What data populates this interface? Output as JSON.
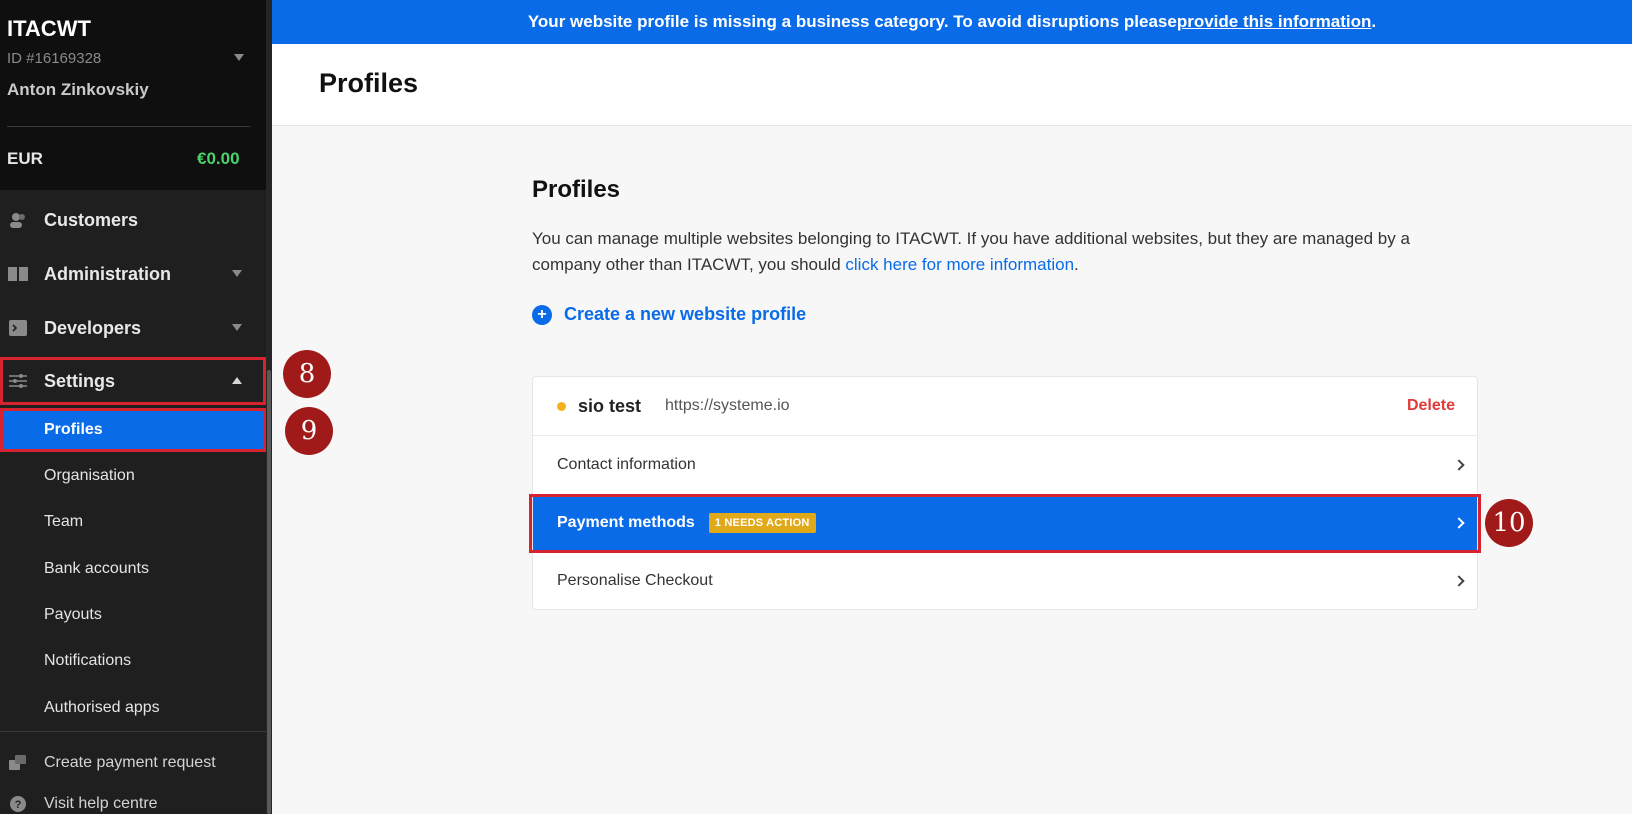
{
  "sidebar": {
    "org_name": "ITACWT",
    "org_id": "ID #16169328",
    "user_name": "Anton Zinkovskiy",
    "currency": "EUR",
    "balance": "€0.00",
    "nav": [
      {
        "label": "Customers",
        "icon": "customers-icon"
      },
      {
        "label": "Administration",
        "icon": "book-icon"
      },
      {
        "label": "Developers",
        "icon": "terminal-icon"
      },
      {
        "label": "Settings",
        "icon": "sliders-icon"
      }
    ],
    "settings_sub": [
      "Profiles",
      "Organisation",
      "Team",
      "Bank accounts",
      "Payouts",
      "Notifications",
      "Authorised apps"
    ],
    "footer": [
      {
        "label": "Create payment request",
        "icon": "payment-request-icon"
      },
      {
        "label": "Visit help centre",
        "icon": "help-icon"
      }
    ]
  },
  "banner": {
    "text": "Your website profile is missing a business category. To avoid disruptions please ",
    "link": "provide this information",
    "end": "."
  },
  "header": {
    "title": "Profiles"
  },
  "main": {
    "section_title": "Profiles",
    "desc_a": "You can manage multiple websites belonging to ITACWT. If you have additional websites, but they are managed by a company other than ITACWT, you should ",
    "desc_link": "click here for more information",
    "desc_end": ".",
    "create_label": "Create a new website profile",
    "profile": {
      "name": "sio test",
      "url": "https://systeme.io",
      "delete_label": "Delete",
      "status_color": "#f5b11d"
    },
    "rows": {
      "contact": "Contact information",
      "payment": "Payment methods",
      "payment_badge": "1 NEEDS ACTION",
      "checkout": "Personalise Checkout"
    }
  },
  "markers": {
    "m8": "8",
    "m9": "9",
    "m10": "10"
  },
  "colors": {
    "accent": "#0a6be8",
    "highlight": "#d7232f",
    "marker": "#a11a1a",
    "positive": "#4ad36a",
    "danger": "#e03a3a"
  }
}
